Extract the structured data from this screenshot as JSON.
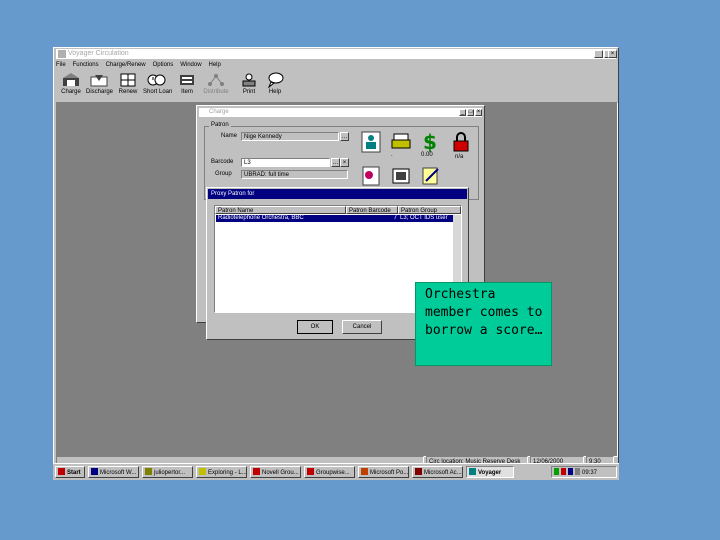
{
  "app": {
    "title": "Voyager Circulation",
    "menu": [
      "File",
      "Functions",
      "Charge/Renew",
      "Options",
      "Window",
      "Help"
    ],
    "toolbar": [
      {
        "label": "Charge",
        "icon": "charge-icon",
        "enabled": true
      },
      {
        "label": "Discharge",
        "icon": "discharge-icon",
        "enabled": true
      },
      {
        "label": "Renew",
        "icon": "renew-icon",
        "enabled": true
      },
      {
        "label": "Short Loan",
        "icon": "short-loan-icon",
        "enabled": true
      },
      {
        "label": "Item",
        "icon": "item-icon",
        "enabled": true
      },
      {
        "label": "Distribute",
        "icon": "distribute-icon",
        "enabled": false
      },
      {
        "label": "Print",
        "icon": "print-icon",
        "enabled": true
      },
      {
        "label": "Help",
        "icon": "help-icon",
        "enabled": true
      }
    ],
    "status": {
      "location": "Circ location: Music Reserve Desk",
      "date": "12/06/2000",
      "time": "9:30"
    }
  },
  "charge_dialog": {
    "title": "Charge",
    "group_label": "Patron",
    "name_label": "Name",
    "name_value": "Nige Kennedy",
    "barcode_label": "Barcode",
    "barcode_value": "L3",
    "group_field_label": "Group",
    "group_value": "UBRAD: full time",
    "fine_label": "0.00",
    "blocks_label": "n/a"
  },
  "proxy_dialog": {
    "title": "Proxy Patron for",
    "columns": [
      "Patron Name",
      "Patron Barcode",
      "Patron Group"
    ],
    "rows": [
      [
        "Radiotelephone Orchestra, BBC",
        "7",
        "L3; OCT IDS user"
      ]
    ],
    "ok_label": "OK",
    "cancel_label": "Cancel"
  },
  "callout": {
    "text": "Orchestra member comes to borrow a score…"
  },
  "taskbar": {
    "start_label": "Start",
    "tasks": [
      "Microsoft W...",
      "juliopertor...",
      "Exploring - L...",
      "Novell Grou...",
      "Groupwise...",
      "Microsoft Po...",
      "Microsoft Ac...",
      "Voyager"
    ],
    "clock": "09:37"
  },
  "colors": {
    "desktop": "#6699cc",
    "window_face": "#c0c0c0",
    "workspace": "#808080",
    "selection": "#000080",
    "callout": "#00cc99"
  }
}
